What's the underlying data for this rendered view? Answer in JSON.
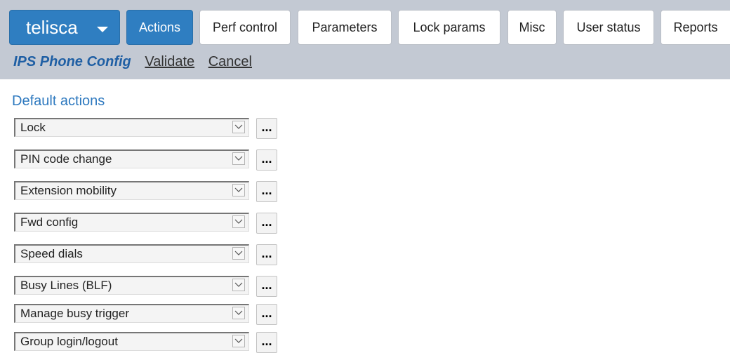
{
  "header": {
    "brand": "telisca",
    "tabs": [
      {
        "label": "Actions",
        "active": true
      },
      {
        "label": "Perf control",
        "active": false
      },
      {
        "label": "Parameters",
        "active": false
      },
      {
        "label": "Lock params",
        "active": false
      },
      {
        "label": "Misc",
        "active": false
      },
      {
        "label": "User status",
        "active": false
      },
      {
        "label": "Reports",
        "active": false
      }
    ]
  },
  "subnav": {
    "title": "IPS Phone Config",
    "validate": "Validate",
    "cancel": "Cancel"
  },
  "section": {
    "title": "Default actions"
  },
  "actions": [
    {
      "value": "Lock",
      "more": "..."
    },
    {
      "value": "PIN code change",
      "more": "..."
    },
    {
      "value": "Extension mobility",
      "more": "..."
    },
    {
      "value": "Fwd config",
      "more": "..."
    },
    {
      "value": "Speed dials",
      "more": "..."
    },
    {
      "value": "Busy Lines (BLF)",
      "more": "..."
    },
    {
      "value": "Manage busy trigger",
      "more": "..."
    },
    {
      "value": "Group login/logout",
      "more": "..."
    }
  ],
  "colors": {
    "header_bg": "#c3c9d3",
    "accent": "#2f7ec1",
    "title": "#1f5fa4",
    "section_title": "#2e79bf"
  }
}
